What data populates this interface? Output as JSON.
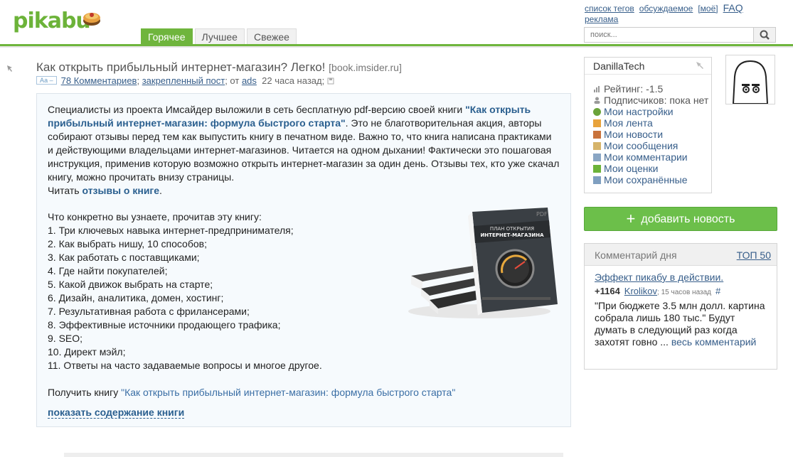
{
  "header": {
    "logo_text": "pikabu",
    "tabs": [
      {
        "label": "Горячее",
        "active": true
      },
      {
        "label": "Лучшее",
        "active": false
      },
      {
        "label": "Свежее",
        "active": false
      }
    ],
    "top_links": {
      "tag_list": "список тегов",
      "discussed": "обсуждаемое",
      "mine": "[моё]",
      "faq": "FAQ",
      "ads": "реклама"
    },
    "search": {
      "placeholder": "поиск..."
    }
  },
  "post": {
    "title": "Как открыть прибыльный интернет-магазин? Легко!",
    "source": "[book.imsider.ru]",
    "text_size_label": "Аа –",
    "comments_link": "78 Комментариев",
    "pinned": "закрепленный пост",
    "from": "; от",
    "author": "ads",
    "time": "22 часа назад",
    "paragraph": {
      "part1": "Специалисты из проекта Имсайдер выложили в сеть бесплатную pdf-версию своей книги ",
      "bold": "\"Как открыть прибыльный интернет-магазин: формула быстрого старта\"",
      "part2": ". Это не благотворительная акция, авторы собирают отзывы перед тем как выпустить книгу в печатном виде. Важно то, что книга написана практиками и действующими владельцами интернет-магазинов. Читается на одном дыхании! Фактически это пошаговая инструкция, применив которую возможно открыть интернет-магазин за один день. Отзывы тех, кто уже скачал книгу, можно прочитать внизу страницы.",
      "read_prefix": "Читать ",
      "read_link": "отзывы о книге",
      "read_suffix": "."
    },
    "list_intro": "Что конкретно вы узнаете, прочитав эту книгу:",
    "list_items": [
      "1. Три ключевых навыка интернет-предпринимателя;",
      "2. Как выбрать нишу, 10 способов;",
      "3. Как работать с поставщиками;",
      "4. Где найти покупателей;",
      "5. Какой движок выбрать на старте;",
      "6. Дизайн, аналитика, домен, хостинг;",
      "7. Результативная работа с фрилансерами;",
      "8. Эффективные источники продающего трафика;",
      "9. SEO;",
      "10. Директ мэйл;",
      "11. Ответы на часто задаваемые вопросы и многое другое."
    ],
    "get_prefix": "Получить книгу ",
    "get_link": "\"Как открыть прибыльный интернет-магазин: формула быстрого старта\"",
    "show_contents": "показать содержание книги",
    "book_cover": {
      "title_line1": "ПЛАН ОТКРЫТИЯ",
      "title_line2": "ИНТЕРНЕТ-МАГАЗИНА",
      "pdf": "PDF"
    }
  },
  "user": {
    "name": "DanillaTech",
    "rating": "Рейтинг: -1.5",
    "subscribers": "Подписчиков: пока нет",
    "menu": [
      {
        "label": "Мои настройки",
        "icon": "gear-icon",
        "color": "#6aa33a"
      },
      {
        "label": "Моя лента",
        "icon": "feed-icon",
        "color": "#e8a33c"
      },
      {
        "label": "Мои новости",
        "icon": "news-icon",
        "color": "#c9733c"
      },
      {
        "label": "Мои сообщения",
        "icon": "envelope-icon",
        "color": "#d6b46a"
      },
      {
        "label": "Мои комментарии",
        "icon": "comments-icon",
        "color": "#8aa6c4"
      },
      {
        "label": "Мои оценки",
        "icon": "ratings-icon",
        "color": "#6cb339"
      },
      {
        "label": "Мои сохранённые",
        "icon": "saved-icon",
        "color": "#7f9fc0"
      }
    ]
  },
  "add_news": {
    "label": "добавить новость",
    "color": "#6cbf4a"
  },
  "comment_of_day": {
    "header": "Комментарий дня",
    "top_link": "ТОП 50",
    "title": "Эффект пикабу в действии.",
    "score": "+1164",
    "author": "Krolikov",
    "time": "; 15 часов назад",
    "hash": "#",
    "text": "\"При бюджете 3.5 млн долл. картина собрала лишь 180 тыс.\" Будут думать в следующий раз когда захотят говно ... ",
    "more": "весь комментарий"
  }
}
